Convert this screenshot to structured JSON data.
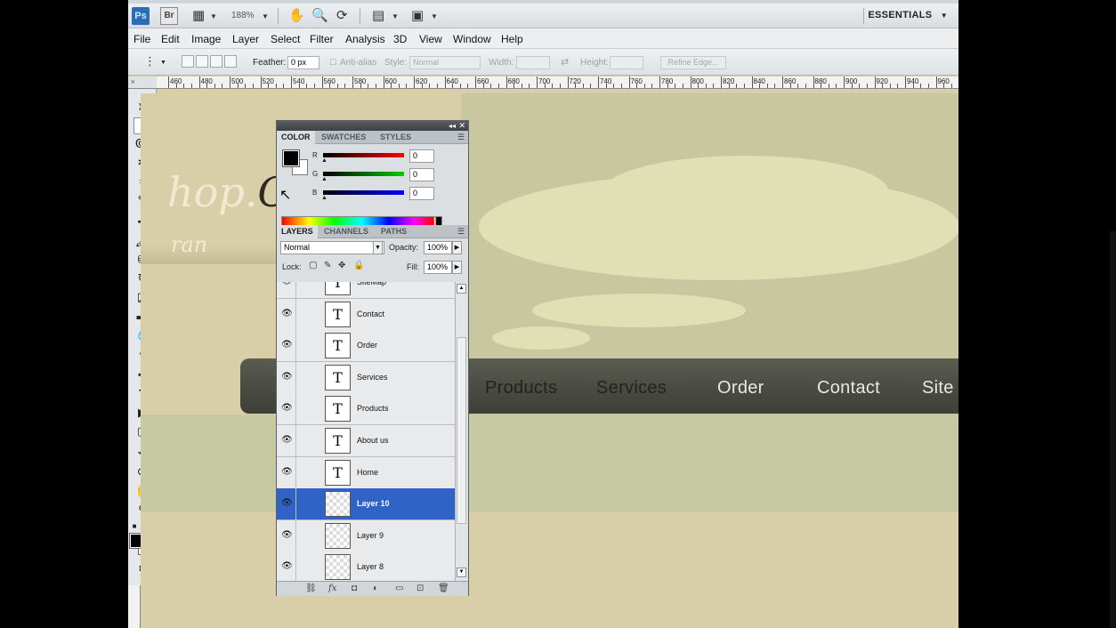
{
  "appbar": {
    "ps_logo": "Ps",
    "br_logo": "Br",
    "zoom": "188%",
    "workspace": "ESSENTIALS"
  },
  "menu": [
    "File",
    "Edit",
    "Image",
    "Layer",
    "Select",
    "Filter",
    "Analysis",
    "3D",
    "View",
    "Window",
    "Help"
  ],
  "options": {
    "feather_label": "Feather:",
    "feather_value": "0 px",
    "antialias_label": "Anti-alias",
    "style_label": "Style:",
    "style_value": "Normal",
    "width_label": "Width:",
    "height_label": "Height:",
    "refine_edge": "Refine Edge..."
  },
  "ruler": {
    "labels": [
      "460",
      "480",
      "500",
      "520",
      "540",
      "560",
      "580",
      "600",
      "620",
      "640",
      "660",
      "680",
      "700",
      "720",
      "740",
      "760",
      "780",
      "800",
      "820",
      "840",
      "860",
      "880",
      "900",
      "920",
      "940",
      "960"
    ]
  },
  "canvas": {
    "script_text_light": "hop.",
    "script_text_dark": "C",
    "script_sub": "ran",
    "nav": {
      "products": "Products",
      "services": "Services",
      "order": "Order",
      "contact": "Contact",
      "site": "Site"
    }
  },
  "color_panel": {
    "tabs": [
      "COLOR",
      "SWATCHES",
      "STYLES"
    ],
    "channels": [
      {
        "label": "R",
        "value": "0"
      },
      {
        "label": "G",
        "value": "0"
      },
      {
        "label": "B",
        "value": "0"
      }
    ],
    "fg_color": "#000000",
    "bg_color": "#ffffff"
  },
  "layers_panel": {
    "tabs": [
      "LAYERS",
      "CHANNELS",
      "PATHS"
    ],
    "blend_mode": "Normal",
    "opacity_label": "Opacity:",
    "opacity_value": "100%",
    "lock_label": "Lock:",
    "fill_label": "Fill:",
    "fill_value": "100%",
    "layers": [
      {
        "name": "SiteMap",
        "kind": "text",
        "thumb": "T",
        "selected": false
      },
      {
        "name": "Contact",
        "kind": "text",
        "thumb": "T",
        "selected": false
      },
      {
        "name": "Order",
        "kind": "text",
        "thumb": "T",
        "selected": false
      },
      {
        "name": "Services",
        "kind": "text",
        "thumb": "T",
        "selected": false
      },
      {
        "name": "Products",
        "kind": "text",
        "thumb": "T",
        "selected": false
      },
      {
        "name": "About us",
        "kind": "text",
        "thumb": "T",
        "selected": false
      },
      {
        "name": "Home",
        "kind": "text",
        "thumb": "T",
        "selected": false
      },
      {
        "name": "Layer 10",
        "kind": "raster",
        "thumb": "",
        "selected": true
      },
      {
        "name": "Layer 9",
        "kind": "raster",
        "thumb": "",
        "selected": false
      },
      {
        "name": "Layer 8",
        "kind": "raster",
        "thumb": "",
        "selected": false
      }
    ]
  },
  "colors": {
    "selection": "#2f63c6",
    "canvas_bg": "#d8cfa9",
    "navbar": "#4a4b42"
  }
}
